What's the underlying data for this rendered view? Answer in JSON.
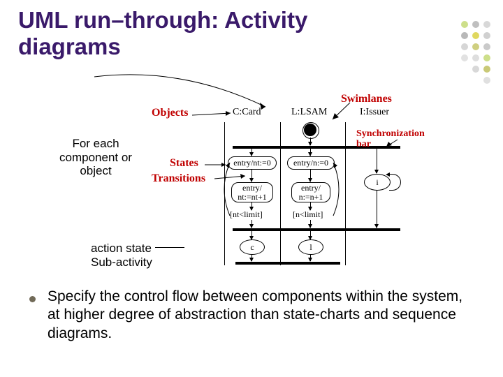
{
  "title": "UML run–through: Activity diagrams",
  "notes": {
    "for_each": "For each component or object",
    "action_state": "action state",
    "sub_activity": "Sub-activity"
  },
  "bullet": "Specify the control flow between components within the system, at higher degree of abstraction than state-charts and sequence diagrams.",
  "diagram": {
    "label_objects": "Objects",
    "label_swimlanes": "Swimlanes",
    "label_states": "States",
    "label_transitions": "Transitions",
    "label_syncbar": "Synchronization bar",
    "lanes": {
      "c": "C:Card",
      "l": "L:LSAM",
      "i": "I:Issuer"
    },
    "state_c": "entry/nt:=0",
    "state_l": "entry/n:=0",
    "trans_c": "entry/ nt:=nt+1",
    "trans_l": "entry/ n:=n+1",
    "guard_c": "[nt<limit]",
    "guard_l": "[n<limit]",
    "loop_i": "i",
    "sub_c": "c",
    "sub_l": "l"
  },
  "dot_colors": [
    "#cddf8a",
    "#e0d85f",
    "#b8b8b8",
    "#d6d6d6",
    "#c9c977",
    "#e2e2e2",
    "#dedede",
    "#d0d0d0",
    "#cfcf80",
    "#cacaca",
    "#d8d8d8",
    "#e0e0e0"
  ]
}
